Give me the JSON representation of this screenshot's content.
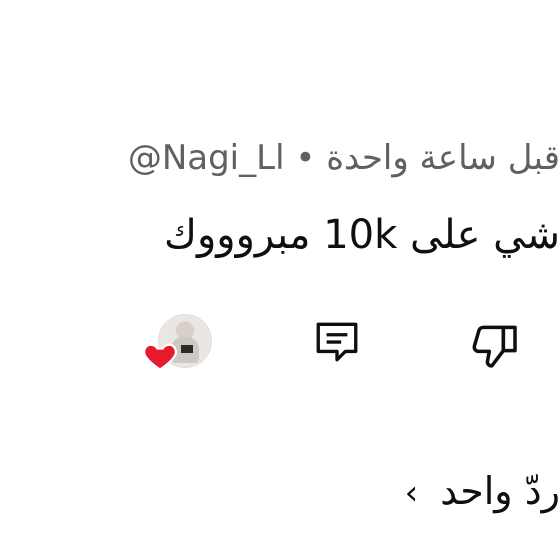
{
  "comment": {
    "handle": "@Nagi_Ll",
    "separator": "•",
    "time_ago": "قبل ساعة واحدة",
    "text": "شي على 10k مبروووك"
  },
  "actions": {
    "creator_heart_icon": "heart-icon",
    "reply_icon": "comment-reply-icon",
    "dislike_icon": "thumbs-down-icon",
    "heart_color": "#e8192c"
  },
  "replies": {
    "label": "ردّ واحد",
    "chevron": "›"
  }
}
